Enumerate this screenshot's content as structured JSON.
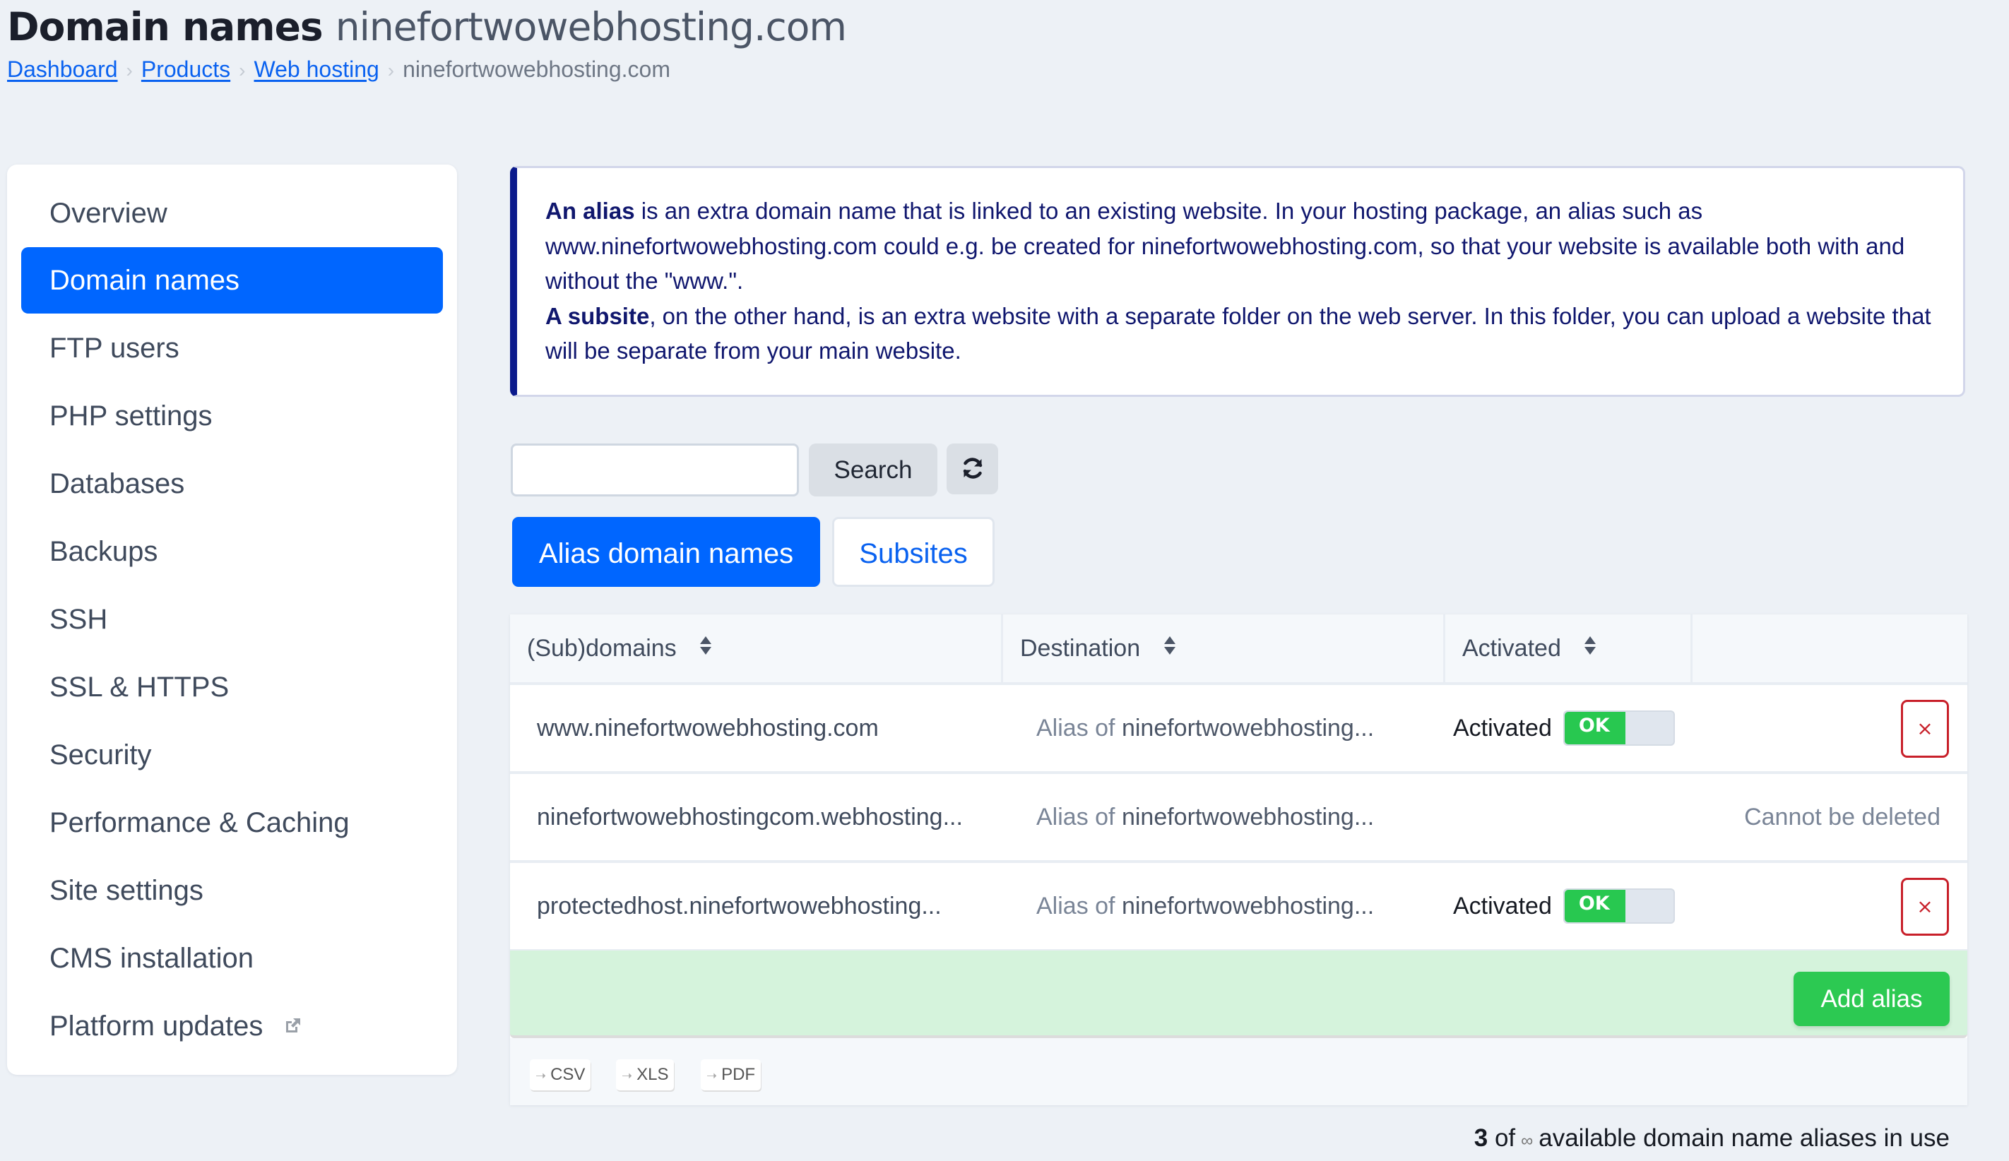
{
  "header": {
    "title_strong": "Domain names",
    "title_light": "ninefortwowebhosting.com"
  },
  "breadcrumb": {
    "items": [
      {
        "label": "Dashboard",
        "link": true
      },
      {
        "label": "Products",
        "link": true
      },
      {
        "label": "Web hosting",
        "link": true
      },
      {
        "label": "ninefortwowebhosting.com",
        "link": false
      }
    ],
    "separator": "›"
  },
  "sidebar": {
    "items": [
      {
        "label": "Overview",
        "active": false
      },
      {
        "label": "Domain names",
        "active": true
      },
      {
        "label": "FTP users",
        "active": false
      },
      {
        "label": "PHP settings",
        "active": false
      },
      {
        "label": "Databases",
        "active": false
      },
      {
        "label": "Backups",
        "active": false
      },
      {
        "label": "SSH",
        "active": false
      },
      {
        "label": "SSL & HTTPS",
        "active": false
      },
      {
        "label": "Security",
        "active": false
      },
      {
        "label": "Performance & Caching",
        "active": false
      },
      {
        "label": "Site settings",
        "active": false
      },
      {
        "label": "CMS installation",
        "active": false
      },
      {
        "label": "Platform updates",
        "active": false,
        "icon": "external-link-icon"
      }
    ]
  },
  "info": {
    "alias_term": "An alias",
    "alias_text": " is an extra domain name that is linked to an existing website. In your hosting package, an alias such as www.ninefortwowebhosting.com could e.g. be created for ninefortwowebhosting.com, so that your website is available both with and without the \"www.\".",
    "subsite_term": "A subsite",
    "subsite_text": ", on the other hand, is an extra website with a separate folder on the web server. In this folder, you can upload a website that will be separate from your main website."
  },
  "search": {
    "value": "",
    "placeholder": "",
    "button_label": "Search",
    "refresh_icon": "refresh-icon"
  },
  "tabs": [
    {
      "label": "Alias domain names",
      "active": true
    },
    {
      "label": "Subsites",
      "active": false
    }
  ],
  "table": {
    "columns": [
      {
        "label": "(Sub)domains",
        "sortable": true
      },
      {
        "label": "Destination",
        "sortable": true
      },
      {
        "label": "Activated",
        "sortable": true
      },
      {
        "label": "",
        "sortable": false
      }
    ],
    "rows": [
      {
        "domain": "www.ninefortwowebhosting.com",
        "dest_prefix": "Alias of ",
        "dest_name": "ninefortwowebhosting...",
        "status": "Activated",
        "toggle": "OK",
        "action": "delete",
        "delete_label": "×"
      },
      {
        "domain": "ninefortwowebhostingcom.webhosting...",
        "dest_prefix": "Alias of ",
        "dest_name": "ninefortwowebhosting...",
        "status": "",
        "toggle": "",
        "action": "none",
        "note": "Cannot be deleted"
      },
      {
        "domain": "protectedhost.ninefortwowebhosting...",
        "dest_prefix": "Alias of ",
        "dest_name": "ninefortwowebhosting...",
        "status": "Activated",
        "toggle": "OK",
        "action": "delete",
        "delete_label": "×"
      }
    ],
    "add_button_label": "Add alias",
    "exports": [
      {
        "label": "CSV"
      },
      {
        "label": "XLS"
      },
      {
        "label": "PDF"
      }
    ],
    "export_arrow": "➝"
  },
  "usage": {
    "used": "3",
    "of": "of",
    "limit": "∞",
    "text": "available domain name aliases in use"
  },
  "colors": {
    "primary": "#0066ff",
    "success": "#2cc952",
    "danger": "#c8202a",
    "info_border": "#0b1a8c",
    "background": "#edf1f6"
  }
}
